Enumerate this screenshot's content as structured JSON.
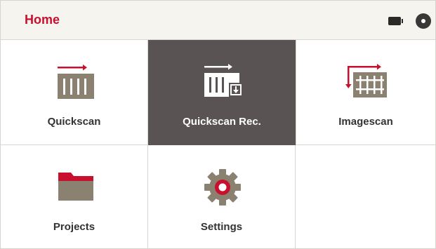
{
  "header": {
    "title": "Home",
    "battery_icon": "battery-icon",
    "disc_icon": "disc-icon"
  },
  "tiles": [
    {
      "label": "Quickscan",
      "icon": "quickscan-icon",
      "active": false
    },
    {
      "label": "Quickscan Rec.",
      "icon": "quickscan-rec-icon",
      "active": true
    },
    {
      "label": "Imagescan",
      "icon": "imagescan-icon",
      "active": false
    },
    {
      "label": "Projects",
      "icon": "folder-icon",
      "active": false
    },
    {
      "label": "Settings",
      "icon": "gear-icon",
      "active": false
    }
  ],
  "colors": {
    "accent": "#c8102e",
    "active_tile": "#595453",
    "icon_gray": "#8a8170",
    "header_bg": "#f6f4ef"
  }
}
